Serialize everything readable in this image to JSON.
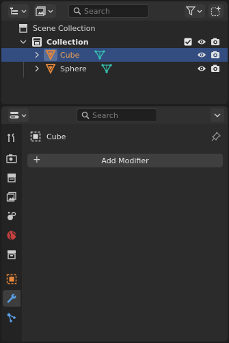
{
  "outliner": {
    "search_placeholder": "Search",
    "scene_collection": "Scene Collection",
    "collection": "Collection",
    "objects": [
      {
        "name": "Cube",
        "selected": true
      },
      {
        "name": "Sphere",
        "selected": false
      }
    ]
  },
  "properties": {
    "search_placeholder": "Search",
    "object_name": "Cube",
    "add_modifier_label": "Add Modifier",
    "active_tab": "modifier-tab",
    "tabs": [
      "tool-tab",
      "render-tab",
      "output-tab",
      "view-layer-tab",
      "scene-tab",
      "world-tab",
      "collection-tab",
      "object-tab",
      "modifier-tab",
      "particles-tab"
    ]
  },
  "colors": {
    "selection": "#334d80",
    "object_orange": "#e8883a",
    "mesh_data_cyan": "#34c4b4",
    "active_name": "#f0a050",
    "panel": "#2b2b2b"
  }
}
